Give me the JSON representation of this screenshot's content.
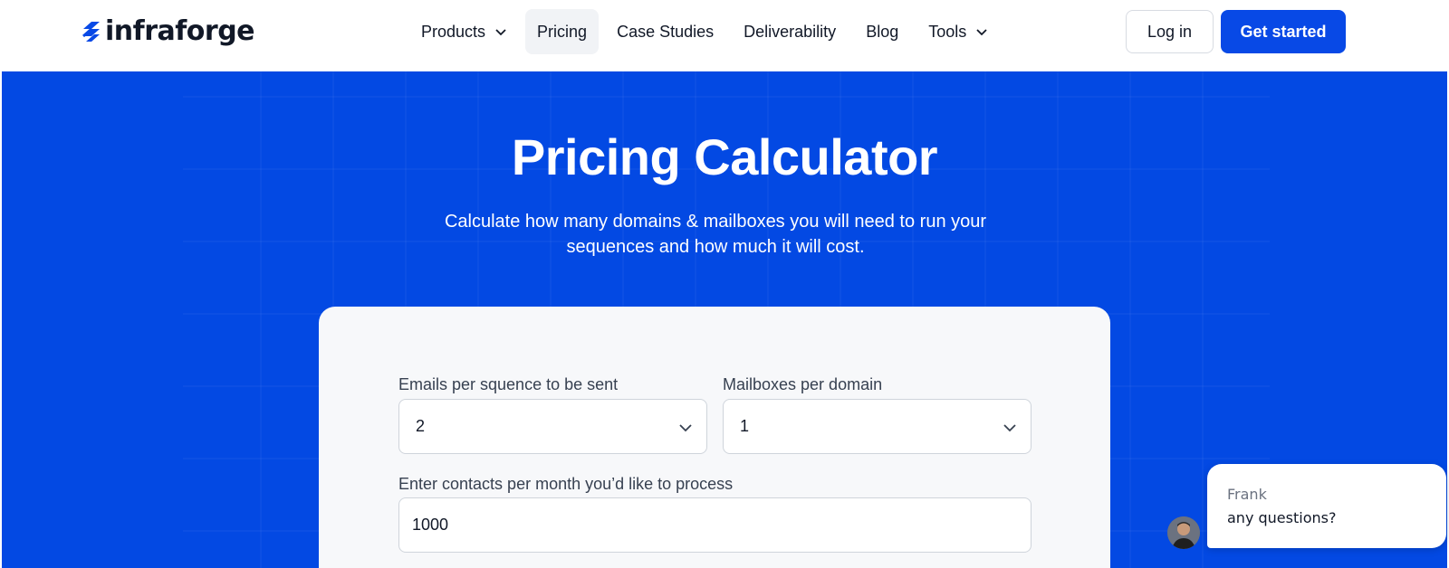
{
  "brand": {
    "name": "infraforge",
    "accent": "#0849e6",
    "hero_bg": "#0349e3"
  },
  "nav": {
    "items": [
      {
        "label": "Products",
        "has_dropdown": true
      },
      {
        "label": "Pricing",
        "active": true
      },
      {
        "label": "Case Studies"
      },
      {
        "label": "Deliverability"
      },
      {
        "label": "Blog"
      },
      {
        "label": "Tools",
        "has_dropdown": true
      }
    ],
    "login_label": "Log in",
    "cta_label": "Get started"
  },
  "hero": {
    "title": "Pricing Calculator",
    "subtitle": "Calculate how many domains & mailboxes you will need to run your sequences and how much it will cost."
  },
  "calculator": {
    "emails_per_sequence": {
      "label": "Emails per squence to be sent",
      "value": "2"
    },
    "mailboxes_per_domain": {
      "label": "Mailboxes per domain",
      "value": "1"
    },
    "contacts_per_month": {
      "label": "Enter contacts per month you’d like to process",
      "value": "1000"
    }
  },
  "chat": {
    "agent_name": "Frank",
    "message": "any questions?"
  }
}
